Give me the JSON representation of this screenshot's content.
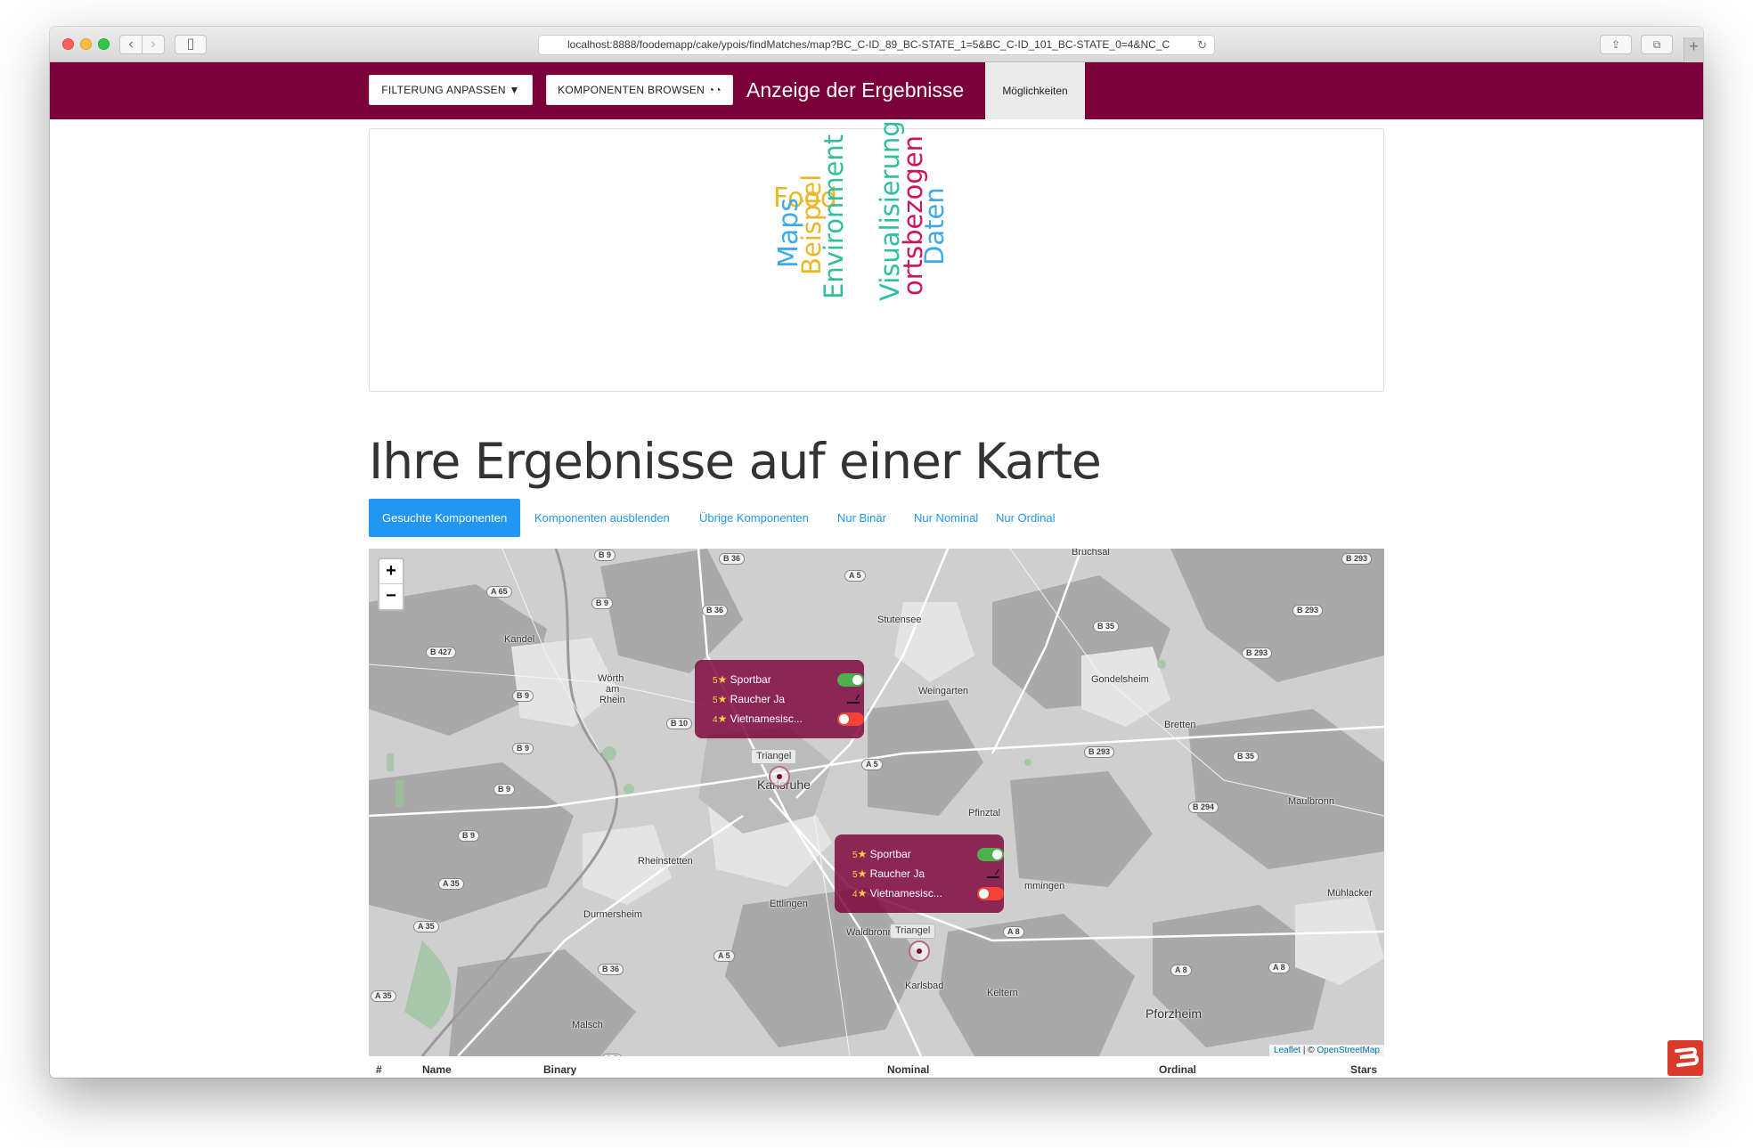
{
  "browser": {
    "url": "localhost:8888/foodemapp/cake/ypois/findMatches/map?BC_C-ID_89_BC-STATE_1=5&BC_C-ID_101_BC-STATE_0=4&NC_C"
  },
  "header": {
    "filter_button": "FILTERUNG ANPASSEN",
    "browse_button": "KOMPONENTEN BROWSEN",
    "title": "Anzeige der Ergebnisse",
    "tab": "Möglichkeiten"
  },
  "word_cloud": {
    "words": [
      "Food",
      "Maps",
      "Beispiel",
      "Environment",
      "Visualisierung",
      "ortsbezogen",
      "Daten"
    ]
  },
  "results": {
    "heading": "Ihre Ergebnisse auf einer Karte",
    "pills": [
      "Gesuchte Komponenten",
      "Komponenten ausblenden",
      "Übrige Komponenten",
      "Nur Binär",
      "Nur Nominal",
      "Nur Ordinal"
    ]
  },
  "map": {
    "zoom_in": "+",
    "zoom_out": "−",
    "attribution_leaflet": "Leaflet",
    "attribution_sep": " | © ",
    "attribution_osm": "OpenStreetMap",
    "places": [
      "Bruchsal",
      "Stutensee",
      "Kandel",
      "Wörth",
      "am",
      "Rhein",
      "Weingarten",
      "Gondelsheim",
      "Bretten",
      "Karlsruhe",
      "Pfinztal",
      "Maulbronn",
      "Rheinstetten",
      "Ettlingen",
      "Durmersheim",
      "Waldbronn",
      "Karlsbad",
      "Keltern",
      "Pforzheim",
      "Mühlacker",
      "Malsch",
      "mmingen"
    ],
    "roads": [
      "B 9",
      "B 36",
      "A 5",
      "B 293",
      "A 65",
      "B 9",
      "B 36",
      "B 293",
      "B 427",
      "B 35",
      "B 293",
      "B 9",
      "B 10",
      "B 9",
      "A 5",
      "B 293",
      "B 35",
      "B 9",
      "B 294",
      "B 9",
      "A 35",
      "A 35",
      "A 8",
      "A 5",
      "B 36",
      "A 8",
      "A 8",
      "A 35",
      "A 5"
    ],
    "popups": [
      {
        "label": "Triangel",
        "rows": [
          {
            "rank": "5",
            "name": "Sportbar",
            "state": "on"
          },
          {
            "rank": "5",
            "name": "Raucher Ja",
            "state": "smoke"
          },
          {
            "rank": "4",
            "name": "Vietnamesisc...",
            "state": "off"
          }
        ]
      },
      {
        "label": "Triangel",
        "rows": [
          {
            "rank": "5",
            "name": "Sportbar",
            "state": "on"
          },
          {
            "rank": "5",
            "name": "Raucher Ja",
            "state": "smoke"
          },
          {
            "rank": "4",
            "name": "Vietnamesisc...",
            "state": "off"
          }
        ]
      }
    ]
  },
  "table": {
    "columns": [
      "#",
      "Name",
      "Binary",
      "Nominal",
      "Ordinal",
      "Stars"
    ]
  },
  "colors": {
    "brand": "#7c0038",
    "accent": "#2196f3"
  }
}
